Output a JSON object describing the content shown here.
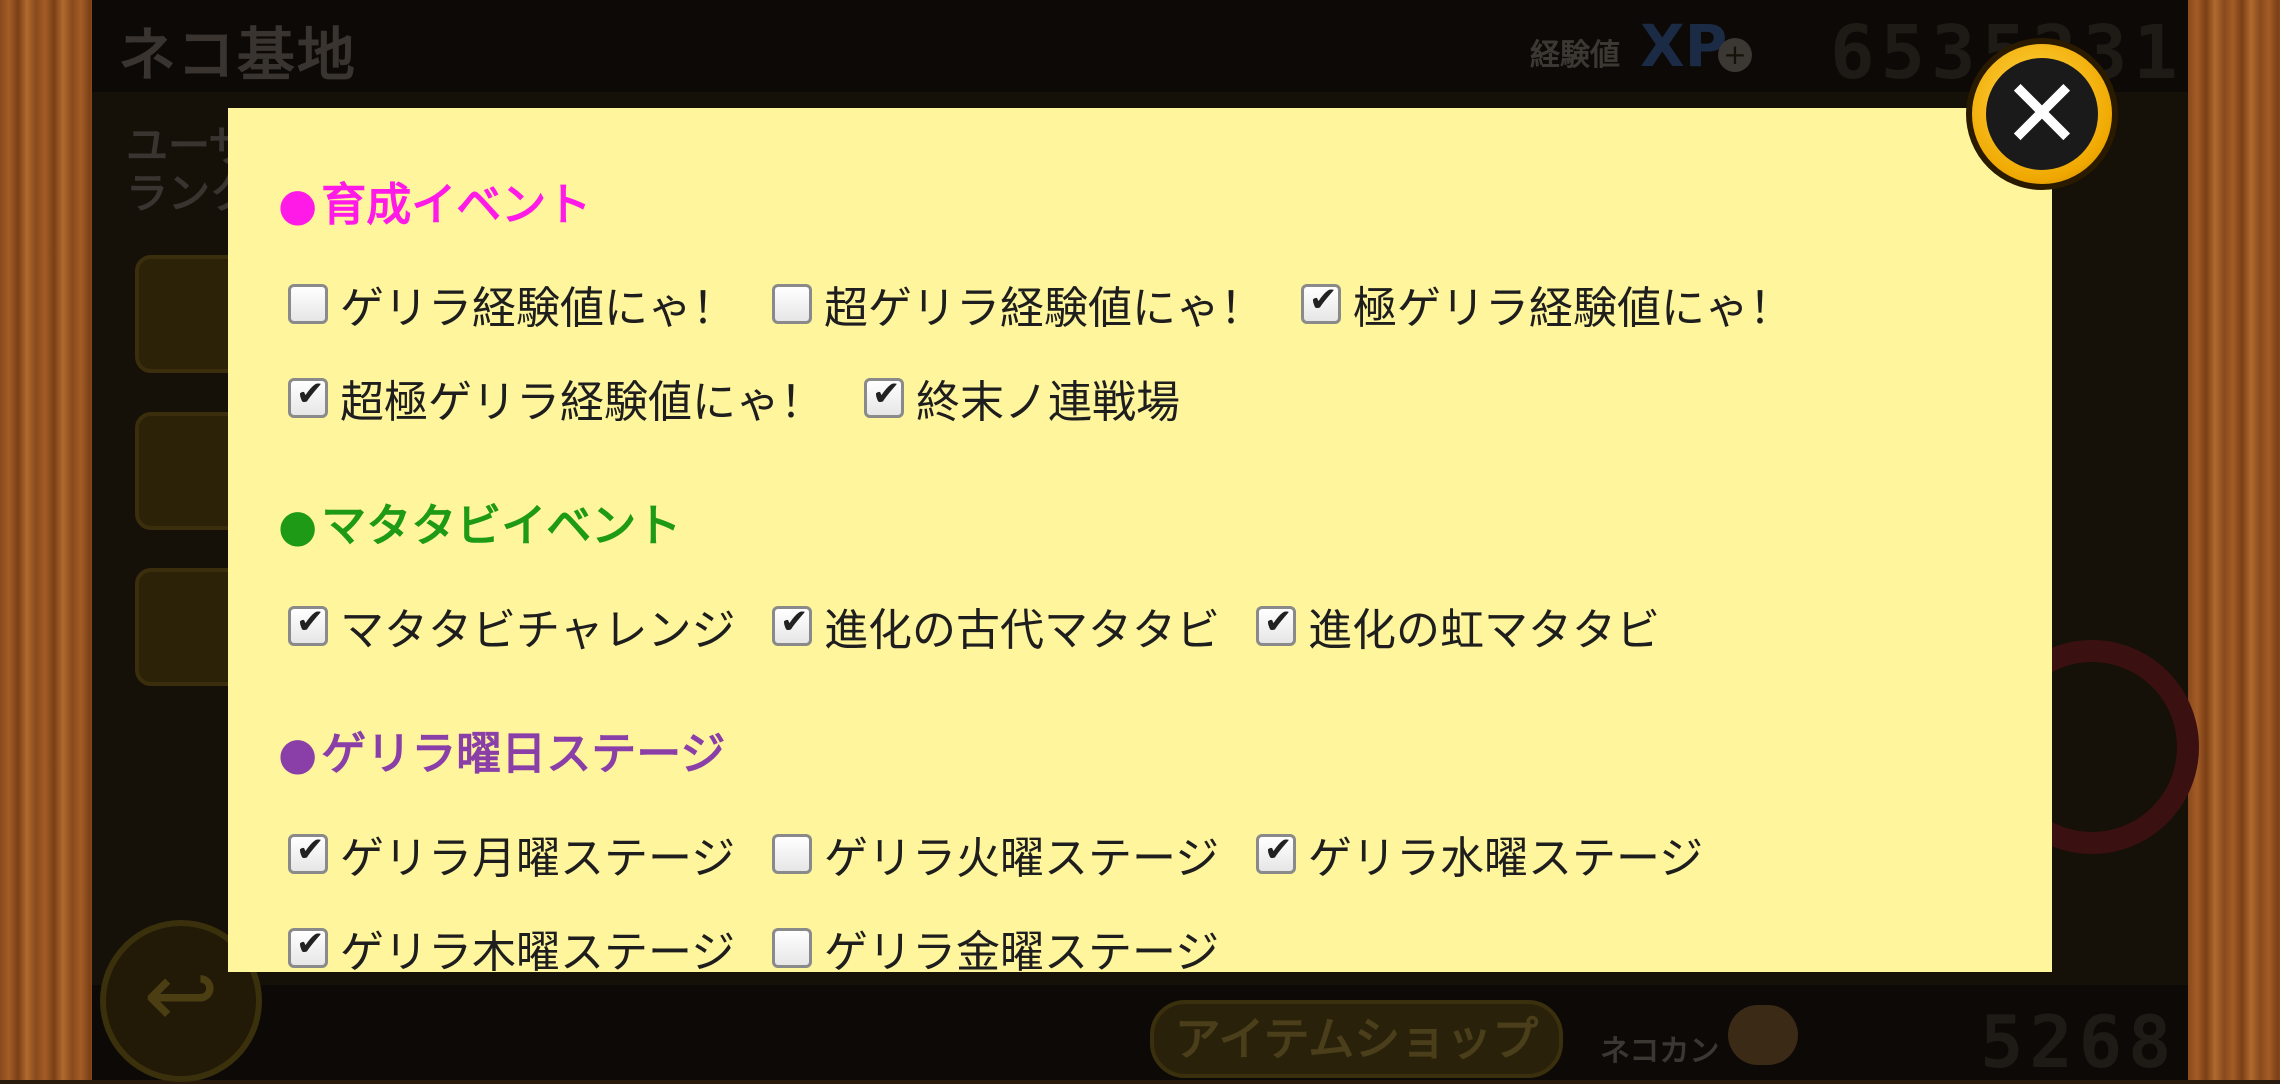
{
  "background": {
    "title": "ネコ基地",
    "xp_label": "経験値",
    "xp_badge": "XP",
    "xp_value": "6535231",
    "left_label": "ユーザー\nランク",
    "shop_button": "アイテムショップ",
    "catfood_label": "ネコカン",
    "catfood_value": "5268"
  },
  "dialog": {
    "sections": [
      {
        "title": "育成イベント",
        "color": "#ff1ae8",
        "options": [
          {
            "label": "ゲリラ経験値にゃ！",
            "checked": false
          },
          {
            "label": "超ゲリラ経験値にゃ！",
            "checked": false
          },
          {
            "label": "極ゲリラ経験値にゃ！",
            "checked": true
          },
          {
            "label": "超極ゲリラ経験値にゃ！",
            "checked": true
          },
          {
            "label": "終末ノ連戦場",
            "checked": true
          }
        ]
      },
      {
        "title": "マタタビイベント",
        "color": "#1f9a17",
        "options": [
          {
            "label": "マタタビチャレンジ",
            "checked": true
          },
          {
            "label": "進化の古代マタタビ",
            "checked": true
          },
          {
            "label": "進化の虹マタタビ",
            "checked": true
          }
        ]
      },
      {
        "title": "ゲリラ曜日ステージ",
        "color": "#8a3fa8",
        "options": [
          {
            "label": "ゲリラ月曜ステージ",
            "checked": true
          },
          {
            "label": "ゲリラ火曜ステージ",
            "checked": false
          },
          {
            "label": "ゲリラ水曜ステージ",
            "checked": true
          },
          {
            "label": "ゲリラ木曜ステージ",
            "checked": true
          },
          {
            "label": "ゲリラ金曜ステージ",
            "checked": false
          }
        ]
      }
    ],
    "close_icon": "close-icon"
  }
}
